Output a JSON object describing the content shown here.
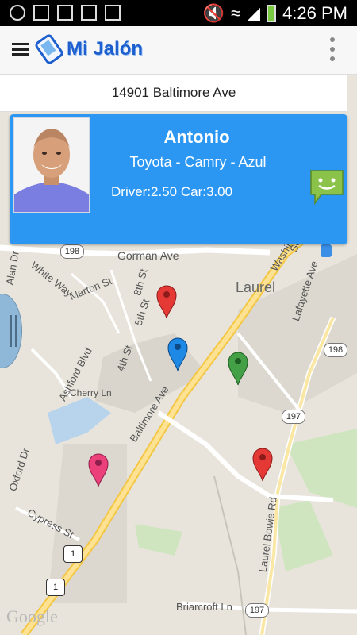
{
  "status_bar": {
    "time": "4:26 PM"
  },
  "app_bar": {
    "title": "Mi Jalón"
  },
  "address_bar": {
    "text": "14901 Baltimore Ave"
  },
  "driver_card": {
    "name": "Antonio",
    "car": "Toyota - Camry - Azul",
    "ratings": "Driver:2.50 Car:3.00"
  },
  "map": {
    "labels": [
      "Gorman Ave",
      "Laurel",
      "White Way",
      "Marton St",
      "8th St",
      "5th St",
      "4th St",
      "Ashford Blvd",
      "Cherry Ln",
      "Baltimore Ave",
      "Oxford Dr",
      "Cypress St",
      "Laurel Bowie Rd",
      "Briarcroft Ln",
      "Lafayette Ave",
      "Alan Dr",
      "Washington",
      "Sec"
    ],
    "shields": [
      "198",
      "198",
      "197",
      "197",
      "1",
      "1"
    ],
    "pin_colors": [
      "#e53935",
      "#1e88e5",
      "#43a047",
      "#e53935",
      "#ec407a"
    ],
    "attribution": "Google"
  }
}
